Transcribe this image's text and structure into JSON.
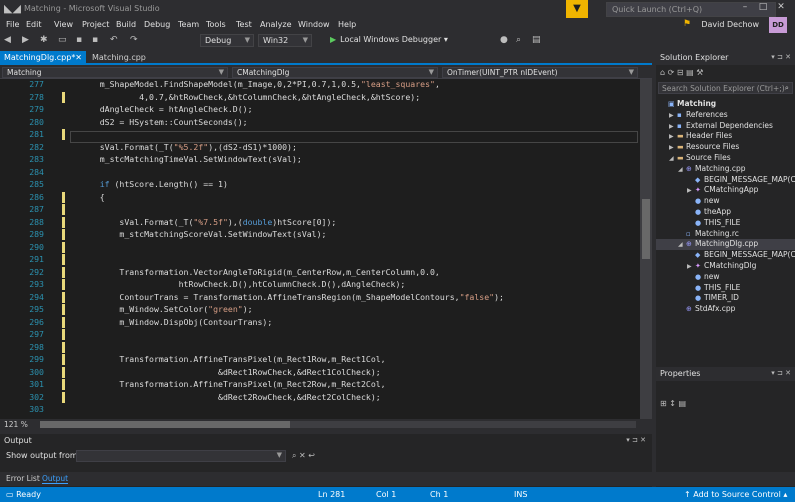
{
  "window": {
    "title": "Matching - Microsoft Visual Studio",
    "quick_launch_placeholder": "Quick Launch (Ctrl+Q)",
    "user_name": "David Dechow",
    "user_initials": "DD",
    "filter_icon": "funnel-icon"
  },
  "menu": [
    "File",
    "Edit",
    "View",
    "Project",
    "Build",
    "Debug",
    "Team",
    "Tools",
    "Test",
    "Analyze",
    "Window",
    "Help"
  ],
  "toolbar": {
    "configuration": "Debug",
    "platform": "Win32",
    "debugger": "Local Windows Debugger"
  },
  "tabs": {
    "active": "MatchingDlg.cpp*",
    "inactive": "Matching.cpp"
  },
  "navbar": {
    "project": "Matching",
    "class": "CMatchingDlg",
    "member": "OnTimer(UINT_PTR nIDEvent)"
  },
  "code_lines": [
    {
      "num": "277",
      "code": "    m_ShapeModel.FindShapeModel(m_Image,0,2*PI,0.7,1,0.5,\"least_squares\","
    },
    {
      "num": "278",
      "code": "            4,0.7,&htRowCheck,&htColumnCheck,&htAngleCheck,&htScore);"
    },
    {
      "num": "279",
      "code": "    dAngleCheck = htAngleCheck.D();"
    },
    {
      "num": "280",
      "code": "    dS2 = HSystem::CountSeconds();"
    },
    {
      "num": "281",
      "code": ""
    },
    {
      "num": "282",
      "code": "    sVal.Format(_T(\"%5.2f\"),(dS2-dS1)*1000);"
    },
    {
      "num": "283",
      "code": "    m_stcMatchingTimeVal.SetWindowText(sVal);"
    },
    {
      "num": "284",
      "code": ""
    },
    {
      "num": "285",
      "code": "    if (htScore.Length() == 1)"
    },
    {
      "num": "286",
      "code": "    {"
    },
    {
      "num": "287",
      "code": ""
    },
    {
      "num": "288",
      "code": "        sVal.Format(_T(\"%7.5f\"),(double)htScore[0]);"
    },
    {
      "num": "289",
      "code": "        m_stcMatchingScoreVal.SetWindowText(sVal);"
    },
    {
      "num": "290",
      "code": ""
    },
    {
      "num": "291",
      "code": ""
    },
    {
      "num": "292",
      "code": "        Transformation.VectorAngleToRigid(m_CenterRow,m_CenterColumn,0.0,"
    },
    {
      "num": "293",
      "code": "                    htRowCheck.D(),htColumnCheck.D(),dAngleCheck);"
    },
    {
      "num": "294",
      "code": "        ContourTrans = Transformation.AffineTransRegion(m_ShapeModelContours,\"false\");"
    },
    {
      "num": "295",
      "code": "        m_Window.SetColor(\"green\");"
    },
    {
      "num": "296",
      "code": "        m_Window.DispObj(ContourTrans);"
    },
    {
      "num": "297",
      "code": ""
    },
    {
      "num": "298",
      "code": ""
    },
    {
      "num": "299",
      "code": "        Transformation.AffineTransPixel(m_Rect1Row,m_Rect1Col,"
    },
    {
      "num": "300",
      "code": "                            &dRect1RowCheck,&dRect1ColCheck);"
    },
    {
      "num": "301",
      "code": "        Transformation.AffineTransPixel(m_Rect2Row,m_Rect2Col,"
    },
    {
      "num": "302",
      "code": "                            &dRect2RowCheck,&dRect2ColCheck);"
    },
    {
      "num": "303",
      "code": ""
    }
  ],
  "editor": {
    "zoom": "121 %"
  },
  "solution_explorer": {
    "title": "Solution Explorer",
    "search_placeholder": "Search Solution Explorer (Ctrl+;)",
    "items": [
      {
        "label": "Matching",
        "indent": 0,
        "twisty": "",
        "icon": "solution-icon",
        "bold": true
      },
      {
        "label": "References",
        "indent": 1,
        "twisty": "▶",
        "icon": "references-icon"
      },
      {
        "label": "External Dependencies",
        "indent": 1,
        "twisty": "▶",
        "icon": "dependencies-icon"
      },
      {
        "label": "Header Files",
        "indent": 1,
        "twisty": "▶",
        "icon": "folder-icon"
      },
      {
        "label": "Resource Files",
        "indent": 1,
        "twisty": "▶",
        "icon": "folder-icon"
      },
      {
        "label": "Source Files",
        "indent": 1,
        "twisty": "◢",
        "icon": "folder-icon"
      },
      {
        "label": "Matching.cpp",
        "indent": 2,
        "twisty": "◢",
        "icon": "cpp-file-icon"
      },
      {
        "label": "BEGIN_MESSAGE_MAP(C",
        "indent": 3,
        "twisty": "",
        "icon": "macro-icon"
      },
      {
        "label": "CMatchingApp",
        "indent": 3,
        "twisty": "▶",
        "icon": "class-icon"
      },
      {
        "label": "new",
        "indent": 3,
        "twisty": "",
        "icon": "symbol-icon"
      },
      {
        "label": "theApp",
        "indent": 3,
        "twisty": "",
        "icon": "symbol-icon"
      },
      {
        "label": "THIS_FILE",
        "indent": 3,
        "twisty": "",
        "icon": "symbol-icon"
      },
      {
        "label": "Matching.rc",
        "indent": 2,
        "twisty": "",
        "icon": "rc-file-icon"
      },
      {
        "label": "MatchingDlg.cpp",
        "indent": 2,
        "twisty": "◢",
        "icon": "cpp-file-icon",
        "selected": true
      },
      {
        "label": "BEGIN_MESSAGE_MAP(C",
        "indent": 3,
        "twisty": "",
        "icon": "macro-icon"
      },
      {
        "label": "CMatchingDlg",
        "indent": 3,
        "twisty": "▶",
        "icon": "class-icon"
      },
      {
        "label": "new",
        "indent": 3,
        "twisty": "",
        "icon": "symbol-icon"
      },
      {
        "label": "THIS_FILE",
        "indent": 3,
        "twisty": "",
        "icon": "symbol-icon"
      },
      {
        "label": "TIMER_ID",
        "indent": 3,
        "twisty": "",
        "icon": "symbol-icon"
      },
      {
        "label": "StdAfx.cpp",
        "indent": 2,
        "twisty": "",
        "icon": "cpp-file-icon"
      }
    ]
  },
  "properties": {
    "title": "Properties"
  },
  "output": {
    "title": "Output",
    "show_from_label": "Show output from:",
    "show_from_value": ""
  },
  "bottom_tabs": [
    "Error List",
    "Output"
  ],
  "status": {
    "ready": "Ready",
    "line": "Ln 281",
    "col": "Col 1",
    "ch": "Ch 1",
    "mode": "INS",
    "source_control": "Add to Source Control"
  },
  "colors": {
    "accent": "#007acc",
    "background": "#1e1e1e",
    "line_number": "#2b91af",
    "string": "#d69d85",
    "keyword": "#569cd6"
  }
}
